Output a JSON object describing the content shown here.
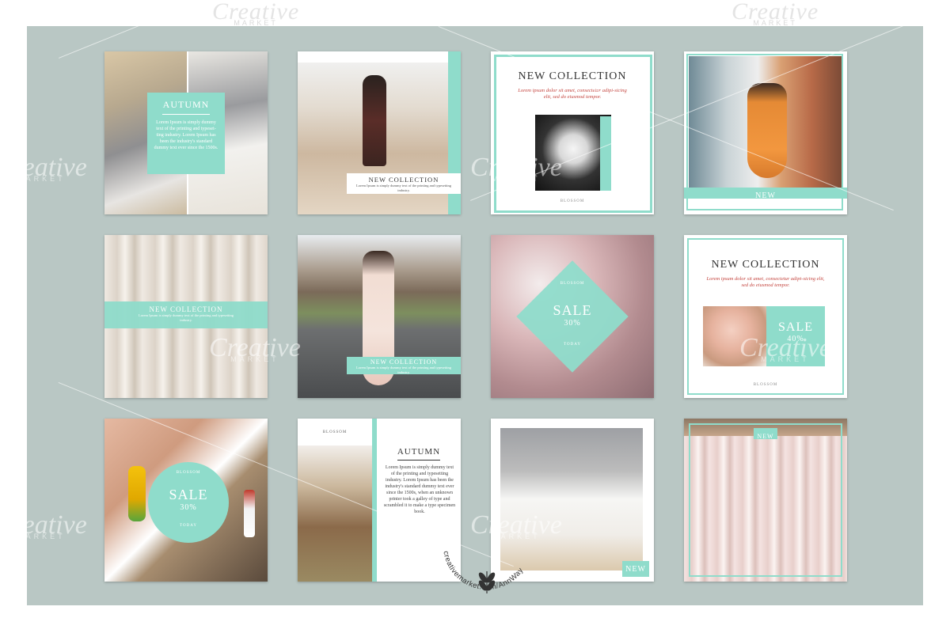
{
  "watermark": {
    "brand": "Creative",
    "sub": "MARKET"
  },
  "colors": {
    "board": "#b9c7c4",
    "mint": "#8fdccb"
  },
  "tiles": [
    {
      "title": "AUTUMN",
      "body": "Lorem Ipsum is simply dummy text of the printing and typeset-ting industry. Lorem Ipsum has been the industry's standard dummy text ever since the 1500s."
    },
    {
      "title": "NEW COLLECTION",
      "body": "Lorem Ipsum is simply dummy text of the printing and typesetting industry."
    },
    {
      "title": "NEW COLLECTION",
      "body": "Lorem ipsum dolor sit amet, consectetur adipi-sicing elit, sed do eiusmod tempor.",
      "brand": "BLOSSOM"
    },
    {
      "tag": "NEW"
    },
    {
      "title": "NEW COLLECTION",
      "body": "Lorem Ipsum is simply dummy text of the printing and typesetting industry."
    },
    {
      "title": "NEW COLLECTION",
      "body": "Lorem Ipsum is simply dummy text of the printing and typesetting industry."
    },
    {
      "brand": "BLOSSOM",
      "title": "SALE",
      "pct": "30%",
      "foot": "TODAY"
    },
    {
      "title": "NEW COLLECTION",
      "body": "Lorem ipsum dolor sit amet, consectetur adipi-sicing elit, sed do eiusmod tempor.",
      "sale": "SALE",
      "pct": "40%",
      "brand": "BLOSSOM"
    },
    {
      "brand": "BLOSSOM",
      "title": "SALE",
      "pct": "30%",
      "foot": "TODAY"
    },
    {
      "brand": "BLOSSOM",
      "title": "AUTUMN",
      "body": "Lorem Ipsum is simply dummy text of the printing and typesetting industry. Lorem Ipsum has been the industry's standard dummy text ever since the 1500s, when an unknown printer took a galley of type and scrambled it to make a type specimen book."
    },
    {
      "tag": "NEW"
    },
    {
      "tag": "NEW"
    }
  ],
  "credit": "creativemarket.com/AnnWay"
}
